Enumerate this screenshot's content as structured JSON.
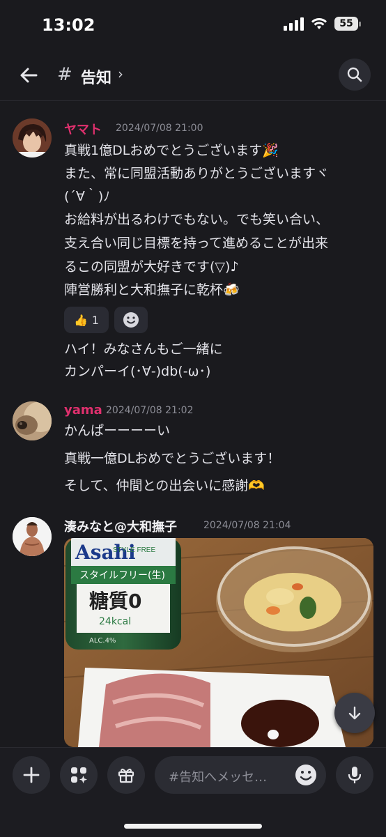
{
  "status": {
    "time": "13:02",
    "battery": "55"
  },
  "header": {
    "hash": "#",
    "channel": "告知",
    "chevron": "›"
  },
  "messages": [
    {
      "user": "ヤマト",
      "user_color": "#e0306e",
      "time": "2024/07/08 21:00",
      "lines": [
        "真戦1億DLおめでとうございます🎉",
        "また、常に同盟活動ありがとうございますヾ",
        "(´∀｀)ﾉ",
        "お給料が出るわけでもない。でも笑い合い、",
        "支え合い同じ目標を持って進めることが出来",
        "るこの同盟が大好きです(▽)♪",
        "陣営勝利と大和撫子に乾杯🍻"
      ],
      "reaction": {
        "emoji": "👍",
        "count": "1"
      },
      "reply_lines": [
        "ハイ！みなさんもご一緒に",
        "カンパーイ(･∀-)db(-ω･)"
      ]
    },
    {
      "user": "yama",
      "user_color": "#e0306e",
      "time": "2024/07/08 21:02",
      "lines": [
        "かんぱーーーーい",
        "真戦一億DLおめでとうございます！",
        "そして、仲間との出会いに感謝🫶"
      ]
    },
    {
      "user": "湊みなと@大和撫子",
      "user_color": "#f1f1f4",
      "time": "2024/07/08 21:04",
      "photo": {
        "bottle_brand": "Asahi",
        "bottle_line1": "STYLE FREE",
        "bottle_line2": "スタイルフリー(生)",
        "bottle_line3": "糖質0",
        "bottle_line4": "24kcal",
        "bottle_line5": "ALC.4%"
      }
    }
  ],
  "composer": {
    "placeholder": "#告知へメッセ…"
  },
  "colors": {
    "background": "#1a1a1e",
    "accent": "#e0306e"
  }
}
